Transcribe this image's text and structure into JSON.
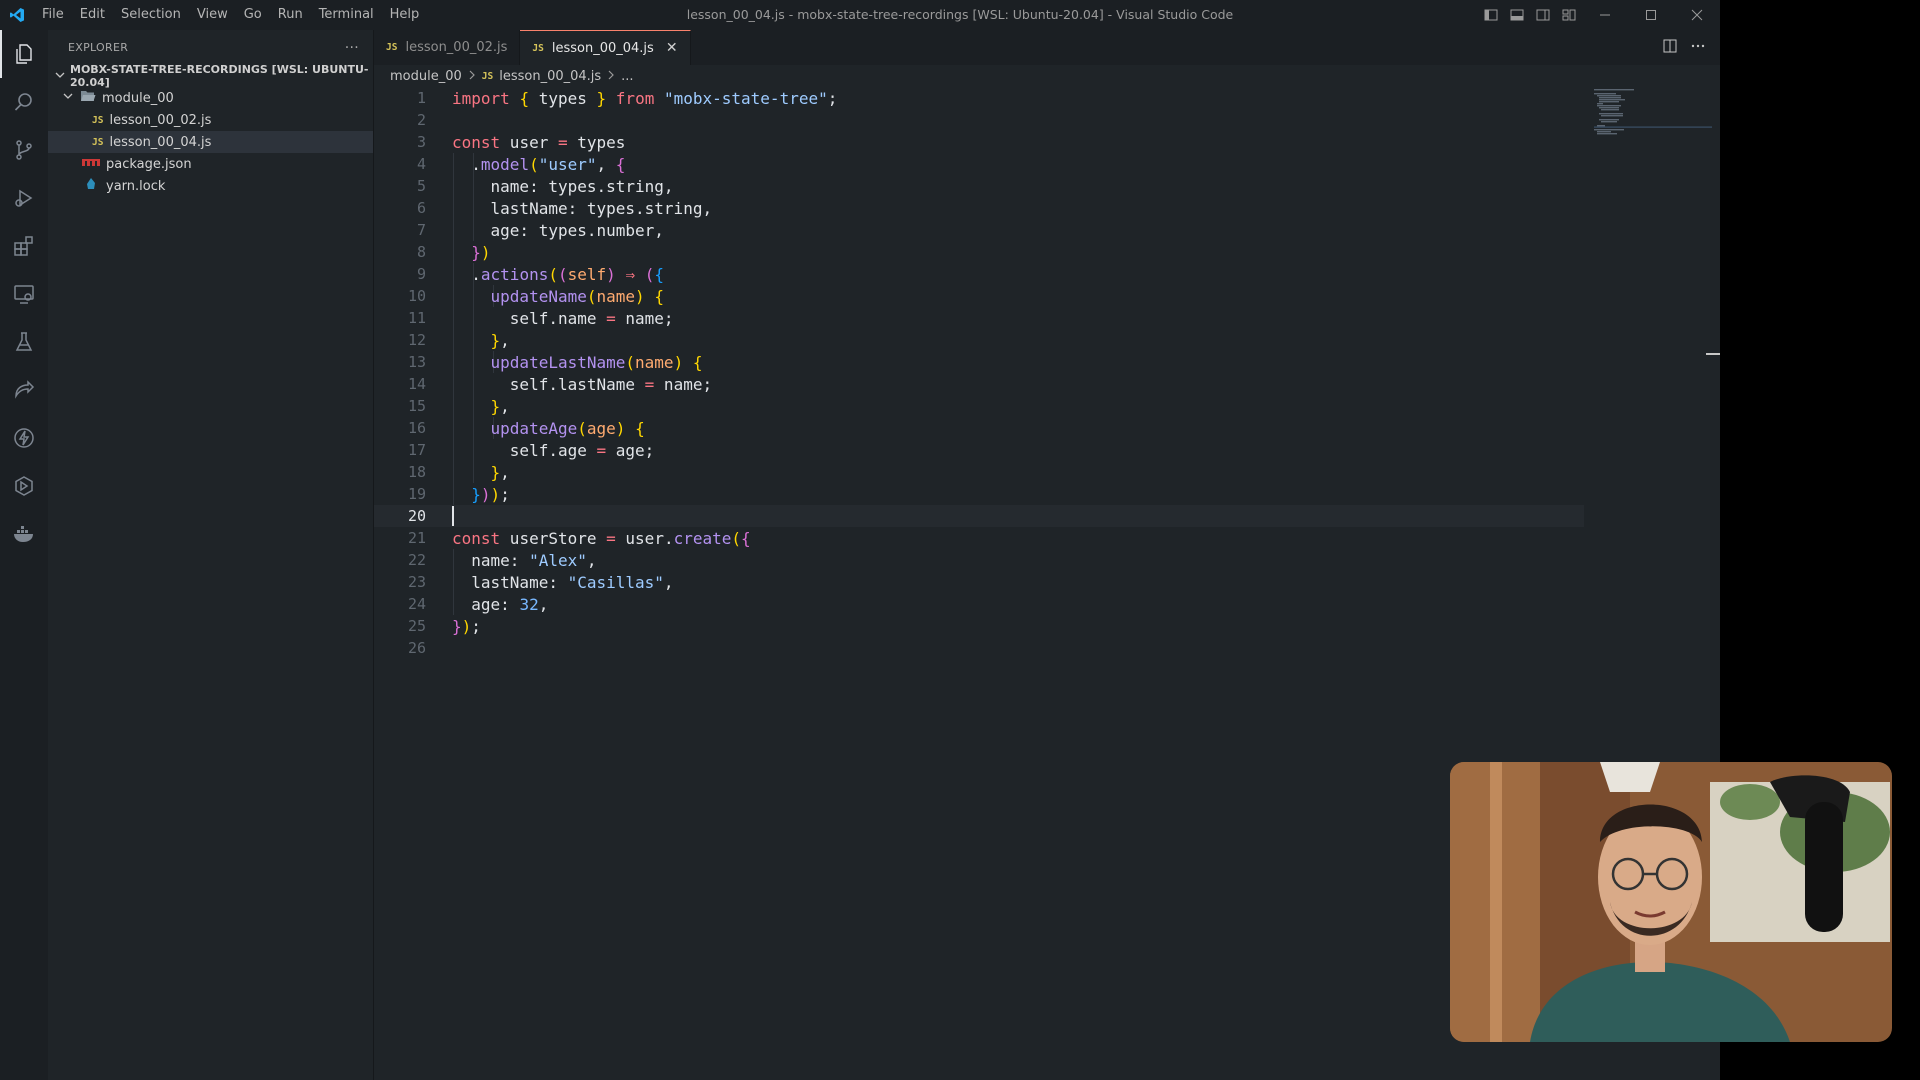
{
  "window_title": "lesson_00_04.js - mobx-state-tree-recordings [WSL: Ubuntu-20.04] - Visual Studio Code",
  "menu": [
    "File",
    "Edit",
    "Selection",
    "View",
    "Go",
    "Run",
    "Terminal",
    "Help"
  ],
  "sidebar": {
    "title": "EXPLORER",
    "more": "···",
    "workspace": "MOBX-STATE-TREE-RECORDINGS [WSL: UBUNTU-20.04]",
    "folder": "module_00",
    "files": [
      {
        "name": "lesson_00_02.js",
        "icon": "js-file-icon"
      },
      {
        "name": "lesson_00_04.js",
        "icon": "js-file-icon",
        "selected": true
      },
      {
        "name": "package.json",
        "icon": "npm-icon"
      },
      {
        "name": "yarn.lock",
        "icon": "yarn-icon"
      }
    ]
  },
  "tabs": [
    {
      "label": "lesson_00_02.js",
      "active": false
    },
    {
      "label": "lesson_00_04.js",
      "active": true
    }
  ],
  "tab_close": "✕",
  "js_glyph": "JS",
  "breadcrumb": {
    "folder": "module_00",
    "file": "lesson_00_04.js",
    "ellipsis": "..."
  },
  "editor": {
    "current_line": 20,
    "line_count": 26
  },
  "colors": {
    "accent": "#f9826c",
    "background": "#1f2428",
    "keyword": "#f97583",
    "string": "#9ecbff",
    "function": "#b392f0"
  }
}
